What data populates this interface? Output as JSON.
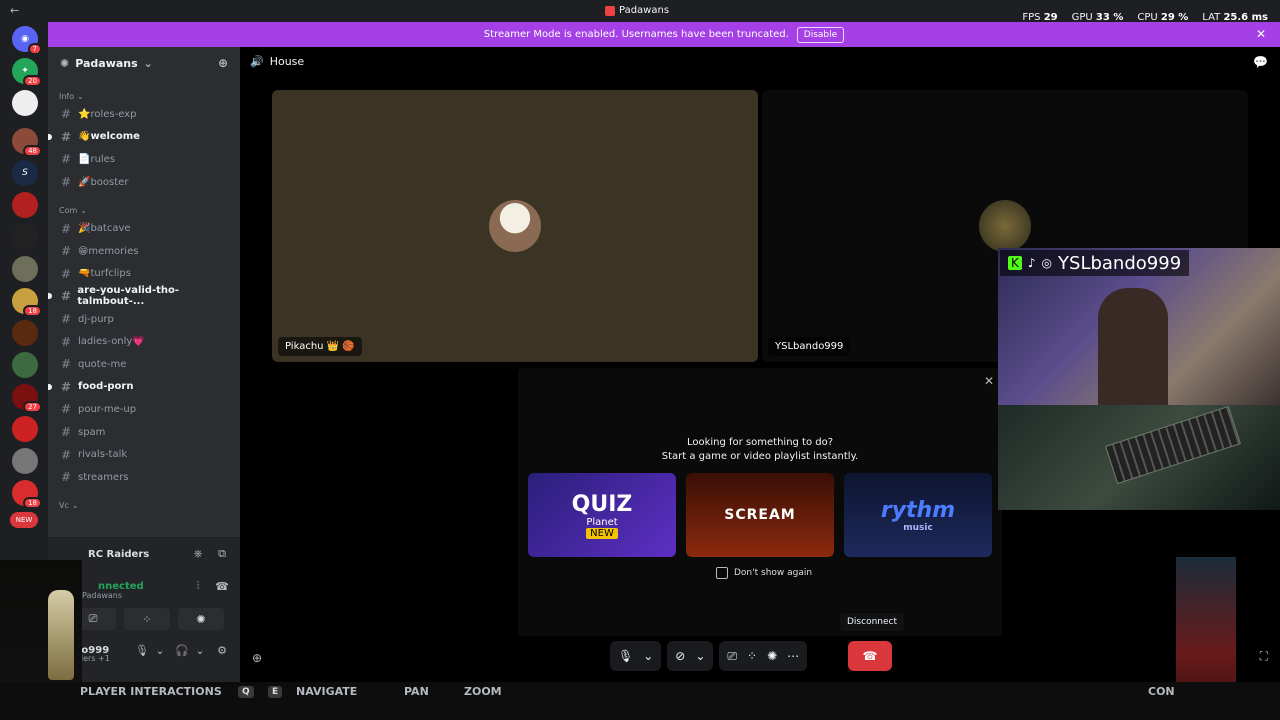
{
  "titlebar": {
    "title": "Padawans",
    "back": "←"
  },
  "stats": [
    {
      "label": "FPS",
      "value": "29"
    },
    {
      "label": "GPU",
      "value": "33 %"
    },
    {
      "label": "CPU",
      "value": "29 %"
    },
    {
      "label": "LAT",
      "value": "25.6 ms"
    }
  ],
  "banner": {
    "text": "Streamer Mode is enabled. Usernames have been truncated.",
    "button": "Disable"
  },
  "server_badges": [
    "7",
    "20",
    "48",
    "18",
    "27",
    "18",
    "NEW"
  ],
  "guild": {
    "name": "Padawans"
  },
  "categories": {
    "info": "Info",
    "com": "Com",
    "vc": "Vc"
  },
  "channels": [
    {
      "name": "⭐roles-exp",
      "unread": false
    },
    {
      "name": "👋welcome",
      "unread": true
    },
    {
      "name": "📄rules",
      "unread": false
    },
    {
      "name": "🚀booster",
      "unread": false
    },
    {
      "name": "🎉batcave",
      "unread": false
    },
    {
      "name": "😁memories",
      "unread": false
    },
    {
      "name": "🔫turfclips",
      "unread": false
    },
    {
      "name": "are-you-valid-tho-talmbout-...",
      "unread": true
    },
    {
      "name": "dj-purp",
      "unread": false
    },
    {
      "name": "ladies-only💗",
      "unread": false
    },
    {
      "name": "quote-me",
      "unread": false
    },
    {
      "name": "food-porn",
      "unread": true
    },
    {
      "name": "pour-me-up",
      "unread": false
    },
    {
      "name": "spam",
      "unread": false
    },
    {
      "name": "rivals-talk",
      "unread": false
    },
    {
      "name": "streamers",
      "unread": false
    }
  ],
  "voice_panel": {
    "activity": "RC Raiders",
    "status": "nnected",
    "server": "Padawans",
    "user": "lo999",
    "user_sub": "ders +1"
  },
  "voice_channel": {
    "name": "House"
  },
  "participants": [
    {
      "name": "Pikachu 👑 🏀"
    },
    {
      "name": "YSLbando999"
    }
  ],
  "activity_prompt": {
    "line1": "Looking for something to do?",
    "line2": "Start a game or video playlist instantly.",
    "cards": [
      {
        "title": "QUIZ",
        "subtitle": "Planet",
        "tag": "NEW"
      },
      {
        "title": "SCREAM"
      },
      {
        "title": "rythm",
        "subtitle": "music"
      }
    ],
    "checkbox_label": "Don't show again"
  },
  "tooltip": "Disconnect",
  "stream_overlay": {
    "handle": "YSLbando999"
  },
  "gamebar": [
    "PLAYER INTERACTIONS",
    "Q",
    "E",
    "NAVIGATE",
    "PAN",
    "ZOOM",
    "CON"
  ],
  "colors": {
    "accent": "#a540e6",
    "danger": "#da373c",
    "sidebar": "#2b2d31"
  }
}
